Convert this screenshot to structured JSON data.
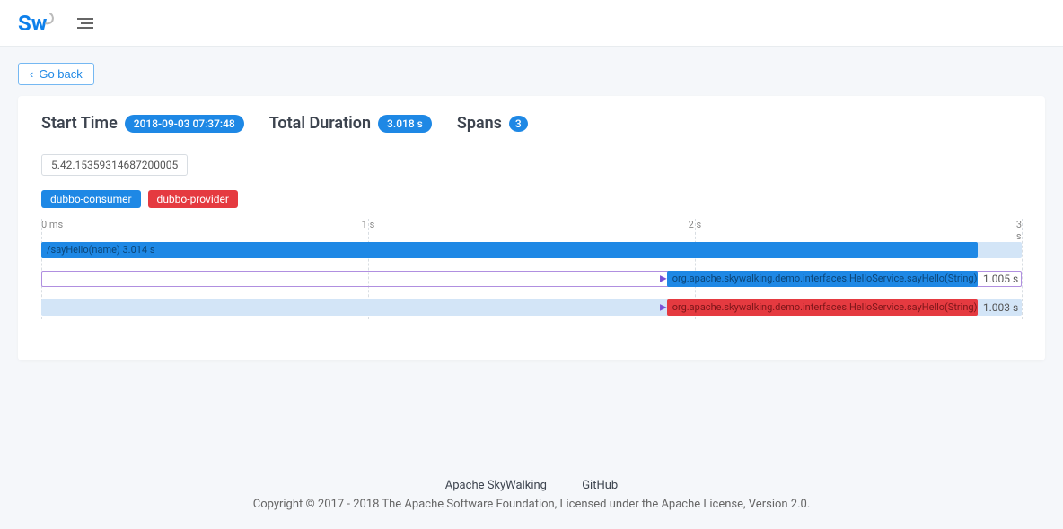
{
  "header": {
    "logo_text": "Sw"
  },
  "goback_label": "Go back",
  "summary": {
    "start_label": "Start Time",
    "start_value": "2018-09-03 07:37:48",
    "duration_label": "Total Duration",
    "duration_value": "3.018 s",
    "spans_label": "Spans",
    "spans_count": "3"
  },
  "trace_id": "5.42.15359314687200005",
  "services": [
    {
      "name": "dubbo-consumer",
      "color": "blue"
    },
    {
      "name": "dubbo-provider",
      "color": "red"
    }
  ],
  "axis": {
    "ticks": [
      "0 ms",
      "1 s",
      "2 s",
      "3 s"
    ],
    "positions_pct": [
      0,
      33.33,
      66.66,
      100
    ]
  },
  "spans": [
    {
      "label": "/sayHello(name) 3.014 s",
      "color": "blue",
      "start_pct": 0,
      "end_pct": 95.5,
      "bg": true,
      "duration": ""
    },
    {
      "label": "org.apache.skywalking.demo.interfaces.HelloService.sayHello(String)",
      "color": "blue",
      "start_pct": 63.8,
      "end_pct": 95.5,
      "outline": true,
      "arrow": true,
      "duration": "1.005 s"
    },
    {
      "label": "org.apache.skywalking.demo.interfaces.HelloService.sayHello(String)",
      "color": "red",
      "start_pct": 63.8,
      "end_pct": 95.5,
      "bg": true,
      "arrow": true,
      "duration": "1.003 s"
    }
  ],
  "footer": {
    "link1": "Apache SkyWalking",
    "link2": "GitHub",
    "copyright": "Copyright © 2017 - 2018 The Apache Software Foundation, Licensed under the Apache License, Version 2.0."
  },
  "chart_data": {
    "type": "gantt",
    "title": "Trace spans",
    "x_unit": "seconds",
    "x_range": [
      0,
      3
    ],
    "series": [
      {
        "name": "/sayHello(name)",
        "service": "dubbo-consumer",
        "start": 0.0,
        "end": 3.014,
        "duration_s": 3.014
      },
      {
        "name": "org.apache.skywalking.demo.interfaces.HelloService.sayHello(String)",
        "service": "dubbo-consumer",
        "start": 2.009,
        "end": 3.014,
        "duration_s": 1.005
      },
      {
        "name": "org.apache.skywalking.demo.interfaces.HelloService.sayHello(String)",
        "service": "dubbo-provider",
        "start": 2.011,
        "end": 3.014,
        "duration_s": 1.003
      }
    ]
  }
}
